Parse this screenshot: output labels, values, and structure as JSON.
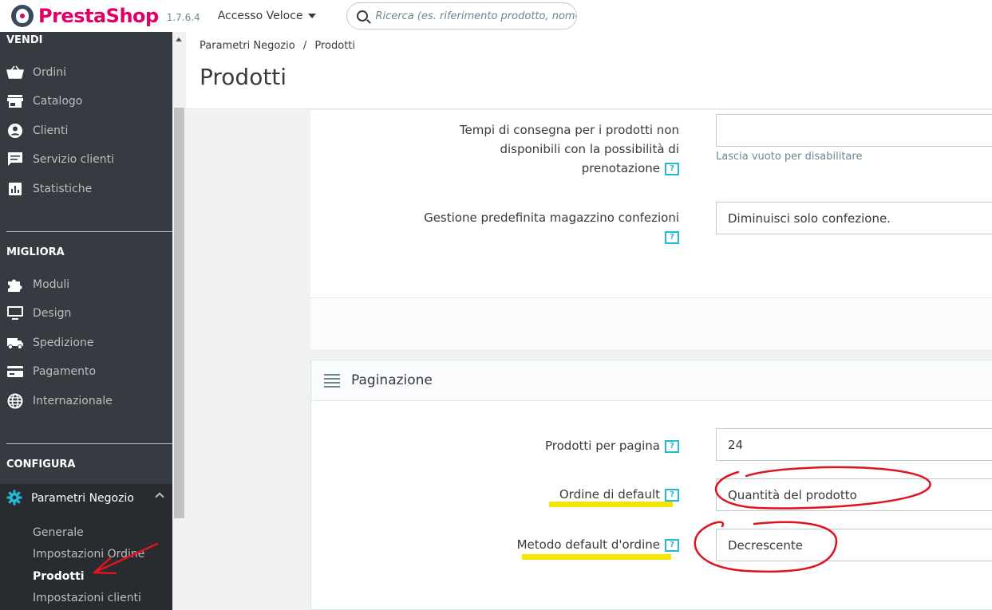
{
  "header": {
    "logo_text": "PrestaShop",
    "version": "1.7.6.4",
    "quick_access": "Accesso Veloce",
    "search_placeholder": "Ricerca (es. riferimento prodotto, nome"
  },
  "sidebar": {
    "sections": [
      {
        "title": "VENDI",
        "items": [
          {
            "label": "Ordini",
            "icon": "basket-icon"
          },
          {
            "label": "Catalogo",
            "icon": "store-icon"
          },
          {
            "label": "Clienti",
            "icon": "user-icon"
          },
          {
            "label": "Servizio clienti",
            "icon": "chat-icon"
          },
          {
            "label": "Statistiche",
            "icon": "chart-icon"
          }
        ]
      },
      {
        "title": "MIGLIORA",
        "items": [
          {
            "label": "Moduli",
            "icon": "puzzle-icon"
          },
          {
            "label": "Design",
            "icon": "monitor-icon"
          },
          {
            "label": "Spedizione",
            "icon": "truck-icon"
          },
          {
            "label": "Pagamento",
            "icon": "card-icon"
          },
          {
            "label": "Internazionale",
            "icon": "globe-icon"
          }
        ]
      },
      {
        "title": "CONFIGURA",
        "items": [
          {
            "label": "Parametri Negozio",
            "icon": "gear-icon",
            "active": true
          }
        ]
      }
    ],
    "submenu": [
      "Generale",
      "Impostazioni Ordine",
      "Prodotti",
      "Impostazioni clienti"
    ],
    "current_submenu": "Prodotti"
  },
  "page": {
    "breadcrumb": [
      "Parametri Negozio",
      "Prodotti"
    ],
    "breadcrumb_separator": "/",
    "title": "Prodotti"
  },
  "stock_panel": {
    "fields": [
      {
        "label_lines": [
          "Tempi di consegna per i prodotti non",
          "disponibili con la possibilità di",
          "prenotazione"
        ],
        "value": "",
        "hint": "Lascia vuoto per disabilitare"
      },
      {
        "label_lines": [
          "Gestione predefinita magazzino confezioni"
        ],
        "value": "Diminuisci solo confezione."
      }
    ]
  },
  "pagination_panel": {
    "title": "Paginazione",
    "fields": [
      {
        "label": "Prodotti per pagina",
        "value": "24"
      },
      {
        "label": "Ordine di default",
        "value": "Quantità del prodotto"
      },
      {
        "label": "Metodo default d'ordine",
        "value": "Decrescente"
      }
    ]
  },
  "help_glyph": "?",
  "colors": {
    "brand": "#df0067",
    "accent": "#25b9d7",
    "sidebar": "#363a41",
    "highlight": "#f5e400",
    "annotation": "#e0141e"
  }
}
